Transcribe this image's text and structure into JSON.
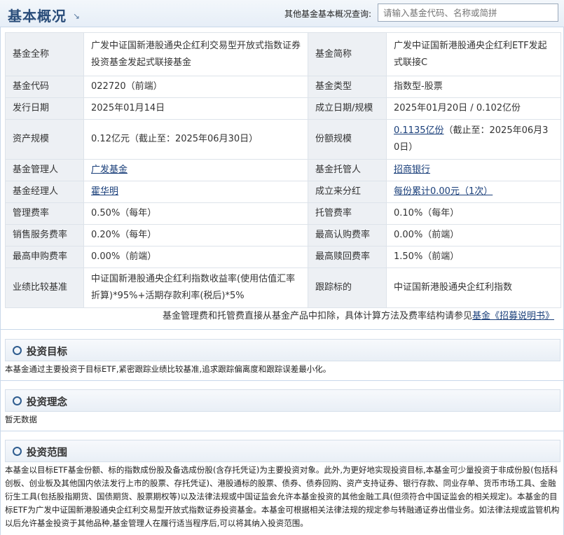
{
  "header": {
    "title": "基本概况",
    "title_icon": "arrow-corner-icon",
    "search_label": "其他基金基本概况查询:",
    "search_placeholder": "请输入基金代码、名称或简拼"
  },
  "info": {
    "full_name_label": "基金全称",
    "full_name": "广发中证国新港股通央企红利交易型开放式指数证券投资基金发起式联接基金",
    "short_name_label": "基金简称",
    "short_name": "广发中证国新港股通央企红利ETF发起式联接C",
    "code_label": "基金代码",
    "code": "022720（前端）",
    "type_label": "基金类型",
    "type": "指数型-股票",
    "issue_date_label": "发行日期",
    "issue_date": "2025年01月14日",
    "establish_label": "成立日期/规模",
    "establish": "2025年01月20日 / 0.102亿份",
    "asset_label": "资产规模",
    "asset": "0.12亿元（截止至：2025年06月30日）",
    "share_label": "份额规模",
    "share_link": "0.1135亿份",
    "share_rest": "（截止至：2025年06月30日）",
    "manager_label": "基金管理人",
    "manager": "广发基金",
    "custodian_label": "基金托管人",
    "custodian": "招商银行",
    "fund_manager_label": "基金经理人",
    "fund_manager": "霍华明",
    "dividend_label": "成立来分红",
    "dividend": "每份累计0.00元（1次）",
    "mgmt_fee_label": "管理费率",
    "mgmt_fee": "0.50%（每年）",
    "custody_fee_label": "托管费率",
    "custody_fee": "0.10%（每年）",
    "sales_fee_label": "销售服务费率",
    "sales_fee": "0.20%（每年）",
    "sub_fee_label": "最高认购费率",
    "sub_fee": "0.00%（前端）",
    "purchase_fee_label": "最高申购费率",
    "purchase_fee": "0.00%（前端）",
    "redeem_fee_label": "最高赎回费率",
    "redeem_fee": "1.50%（前端）",
    "benchmark_label": "业绩比较基准",
    "benchmark": "中证国新港股通央企红利指数收益率(使用估值汇率折算)*95%+活期存款利率(税后)*5%",
    "tracking_label": "跟踪标的",
    "tracking": "中证国新港股通央企红利指数"
  },
  "note": {
    "text": "基金管理费和托管费直接从基金产品中扣除，具体计算方法及费率结构请参见",
    "link": "基金《招募说明书》"
  },
  "sections": {
    "goal_title": "投资目标",
    "goal_text": "本基金通过主要投资于目标ETF,紧密跟踪业绩比较基准,追求跟踪偏离度和跟踪误差最小化。",
    "idea_title": "投资理念",
    "idea_text": "暂无数据",
    "scope_title": "投资范围",
    "scope_text": "本基金以目标ETF基金份额、标的指数成份股及备选成份股(含存托凭证)为主要投资对象。此外,为更好地实现投资目标,本基金可少量投资于非成份股(包括科创板、创业板及其他国内依法发行上市的股票、存托凭证)、港股通标的股票、债券、债券回购、资产支持证券、银行存款、同业存单、货币市场工具、金融衍生工具(包括股指期货、国债期货、股票期权等)以及法律法规或中国证监会允许本基金投资的其他金融工具(但须符合中国证监会的相关规定)。本基金的目标ETF为广发中证国新港股通央企红利交易型开放式指数证券投资基金。本基金可根据相关法律法规的规定参与转融通证券出借业务。如法律法规或监管机构以后允许基金投资于其他品种,基金管理人在履行适当程序后,可以将其纳入投资范围。"
  }
}
